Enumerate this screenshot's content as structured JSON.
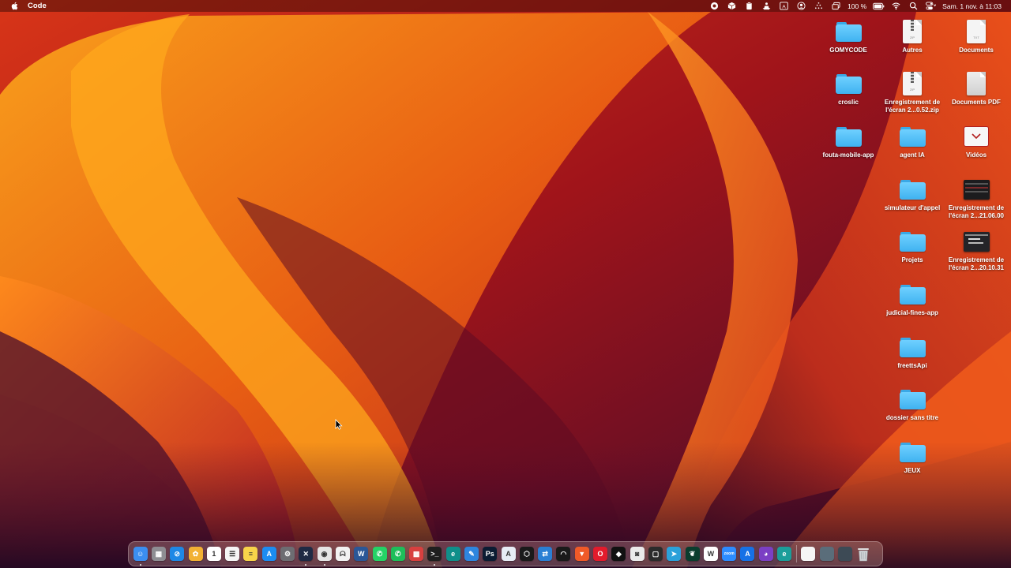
{
  "menubar": {
    "app_name": "Code",
    "battery_percent": "100 %",
    "datetime": "Sam. 1 nov. à 11:03",
    "status_icons": [
      "record-icon",
      "box-icon",
      "clipboard-icon",
      "teacher-icon",
      "input-source-icon",
      "account-icon",
      "dots-icon",
      "window-icon",
      "battery-icon",
      "wifi-icon",
      "search-icon",
      "control-center-icon"
    ],
    "input_source_letter": "A"
  },
  "desktop_icons": [
    {
      "label": "GOMYCODE",
      "type": "folder"
    },
    {
      "label": "Autres",
      "type": "zip"
    },
    {
      "label": "Documents",
      "type": "txt"
    },
    {
      "label": "croslic",
      "type": "folder"
    },
    {
      "label": "Enregistrement de l'écran 2...0.52.zip",
      "type": "zip"
    },
    {
      "label": "Documents PDF",
      "type": "pdf"
    },
    {
      "label": "fouta-mobile-app",
      "type": "folder"
    },
    {
      "label": "agent IA",
      "type": "folder"
    },
    {
      "label": "Vidéos",
      "type": "video-folder"
    },
    {
      "label": "simulateur d'appel",
      "type": "folder"
    },
    {
      "label": "Enregistrement de l'écran 2...21.06.00",
      "type": "screenshot"
    },
    {
      "label": "Projets",
      "type": "folder"
    },
    {
      "label": "Enregistrement de l'écran 2...20.10.31",
      "type": "screenshot"
    },
    {
      "label": "judicial-fines-app",
      "type": "folder"
    },
    {
      "label": "freettsApi",
      "type": "folder"
    },
    {
      "label": "dossier sans titre",
      "type": "folder"
    },
    {
      "label": "JEUX",
      "type": "folder"
    }
  ],
  "file_tags": {
    "zip": "ZIP",
    "txt": "TXT"
  },
  "dock": {
    "apps": [
      {
        "name": "finder",
        "color": "#3b8ef0",
        "glyph": "☺",
        "running": true
      },
      {
        "name": "launchpad",
        "color": "#8e8e93",
        "glyph": "▦",
        "running": false
      },
      {
        "name": "safari",
        "color": "#1e88e5",
        "glyph": "⊘",
        "running": false
      },
      {
        "name": "photos",
        "color": "#f2b134",
        "glyph": "✿",
        "running": false
      },
      {
        "name": "calendar",
        "color": "#ffffff",
        "glyph": "1",
        "running": false
      },
      {
        "name": "reminders",
        "color": "#f5f5f5",
        "glyph": "☰",
        "running": false
      },
      {
        "name": "notes",
        "color": "#f7d34a",
        "glyph": "≡",
        "running": false
      },
      {
        "name": "app-store",
        "color": "#1c8cf2",
        "glyph": "A",
        "running": false
      },
      {
        "name": "system-settings",
        "color": "#6d6d72",
        "glyph": "⚙",
        "running": false
      },
      {
        "name": "vscode",
        "color": "#1f2a44",
        "glyph": "✕",
        "running": true
      },
      {
        "name": "chrome",
        "color": "#e5e5e5",
        "glyph": "◉",
        "running": true
      },
      {
        "name": "ollama",
        "color": "#f2f2f2",
        "glyph": "ᗣ",
        "running": false
      },
      {
        "name": "word",
        "color": "#2b5797",
        "glyph": "W",
        "running": false
      },
      {
        "name": "whatsapp",
        "color": "#25d366",
        "glyph": "✆",
        "running": false
      },
      {
        "name": "whatsapp-business",
        "color": "#1ebe5a",
        "glyph": "✆",
        "running": false
      },
      {
        "name": "rubik",
        "color": "#d8403f",
        "glyph": "▩",
        "running": false
      },
      {
        "name": "terminal",
        "color": "#1f1f1f",
        "glyph": ">_",
        "running": true
      },
      {
        "name": "edge",
        "color": "#0f8f8a",
        "glyph": "e",
        "running": false
      },
      {
        "name": "xcode",
        "color": "#2e86de",
        "glyph": "✎",
        "running": false
      },
      {
        "name": "photoshop",
        "color": "#0b1c33",
        "glyph": "Ps",
        "running": false
      },
      {
        "name": "instruments",
        "color": "#e6ecf5",
        "glyph": "A",
        "running": false
      },
      {
        "name": "codepen",
        "color": "#1a1a1a",
        "glyph": "⬡",
        "running": false
      },
      {
        "name": "remote-desktop",
        "color": "#2a7fd4",
        "glyph": "⇄",
        "running": false
      },
      {
        "name": "airdroid",
        "color": "#1a1a1a",
        "glyph": "◠",
        "running": false
      },
      {
        "name": "brave",
        "color": "#f05a28",
        "glyph": "▼",
        "running": false
      },
      {
        "name": "opera",
        "color": "#e21b2c",
        "glyph": "O",
        "running": false
      },
      {
        "name": "unity",
        "color": "#111111",
        "glyph": "◆",
        "running": false
      },
      {
        "name": "android-studio",
        "color": "#eaeaea",
        "glyph": "◙",
        "running": false
      },
      {
        "name": "display-app",
        "color": "#2b2b2b",
        "glyph": "▢",
        "running": false
      },
      {
        "name": "telegram",
        "color": "#2aa1da",
        "glyph": "➤",
        "running": false
      },
      {
        "name": "mongodb-compass",
        "color": "#0a3d2e",
        "glyph": "❦",
        "running": false
      },
      {
        "name": "wikipedia",
        "color": "#ffffff",
        "glyph": "W",
        "running": false
      },
      {
        "name": "zoom",
        "color": "#2d8cff",
        "glyph": "zoom",
        "running": false
      },
      {
        "name": "xcode-sim",
        "color": "#1671e6",
        "glyph": "A",
        "running": false
      },
      {
        "name": "github-desktop",
        "color": "#7b3fc4",
        "glyph": "◕",
        "running": false
      },
      {
        "name": "edge-dev",
        "color": "#1b9e9a",
        "glyph": "e",
        "running": false
      }
    ],
    "stacks": [
      {
        "name": "documents-stack",
        "color": "#f5f5f5"
      },
      {
        "name": "downloads-stack",
        "color": "#5a6d7a"
      },
      {
        "name": "recent-stack",
        "color": "#3d4a55"
      }
    ],
    "trash": {
      "name": "trash"
    }
  }
}
